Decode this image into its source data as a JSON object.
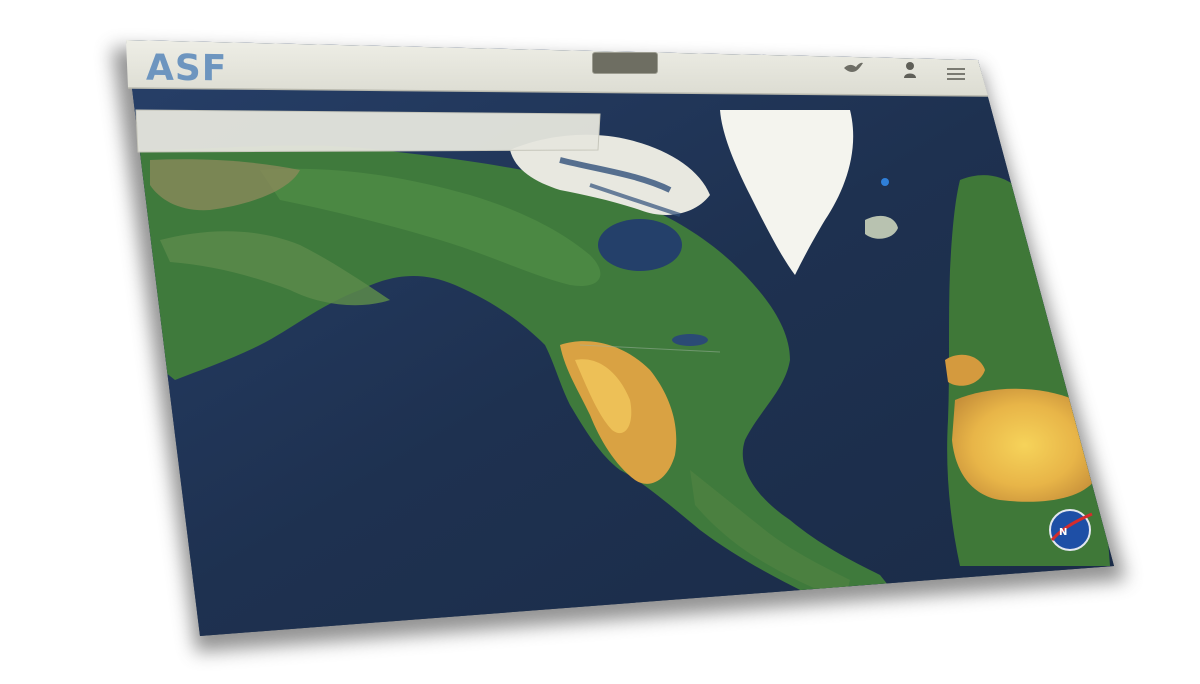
{
  "header": {
    "logo_text": "ASF",
    "logo_sub": "",
    "center_button": "",
    "nav_items": []
  },
  "search_bar": {
    "text": ""
  },
  "map": {
    "ocean_color": "#1f3352",
    "land_color": "#3f7a3c",
    "ice_color": "#f2f2ec",
    "desert_color": "#e7b24a",
    "marker_color": "#2f7fd8"
  },
  "icons": {
    "bird": "bird-icon",
    "user": "user-icon",
    "menu": "hamburger-menu-icon",
    "badge": "nasa-badge-icon"
  }
}
